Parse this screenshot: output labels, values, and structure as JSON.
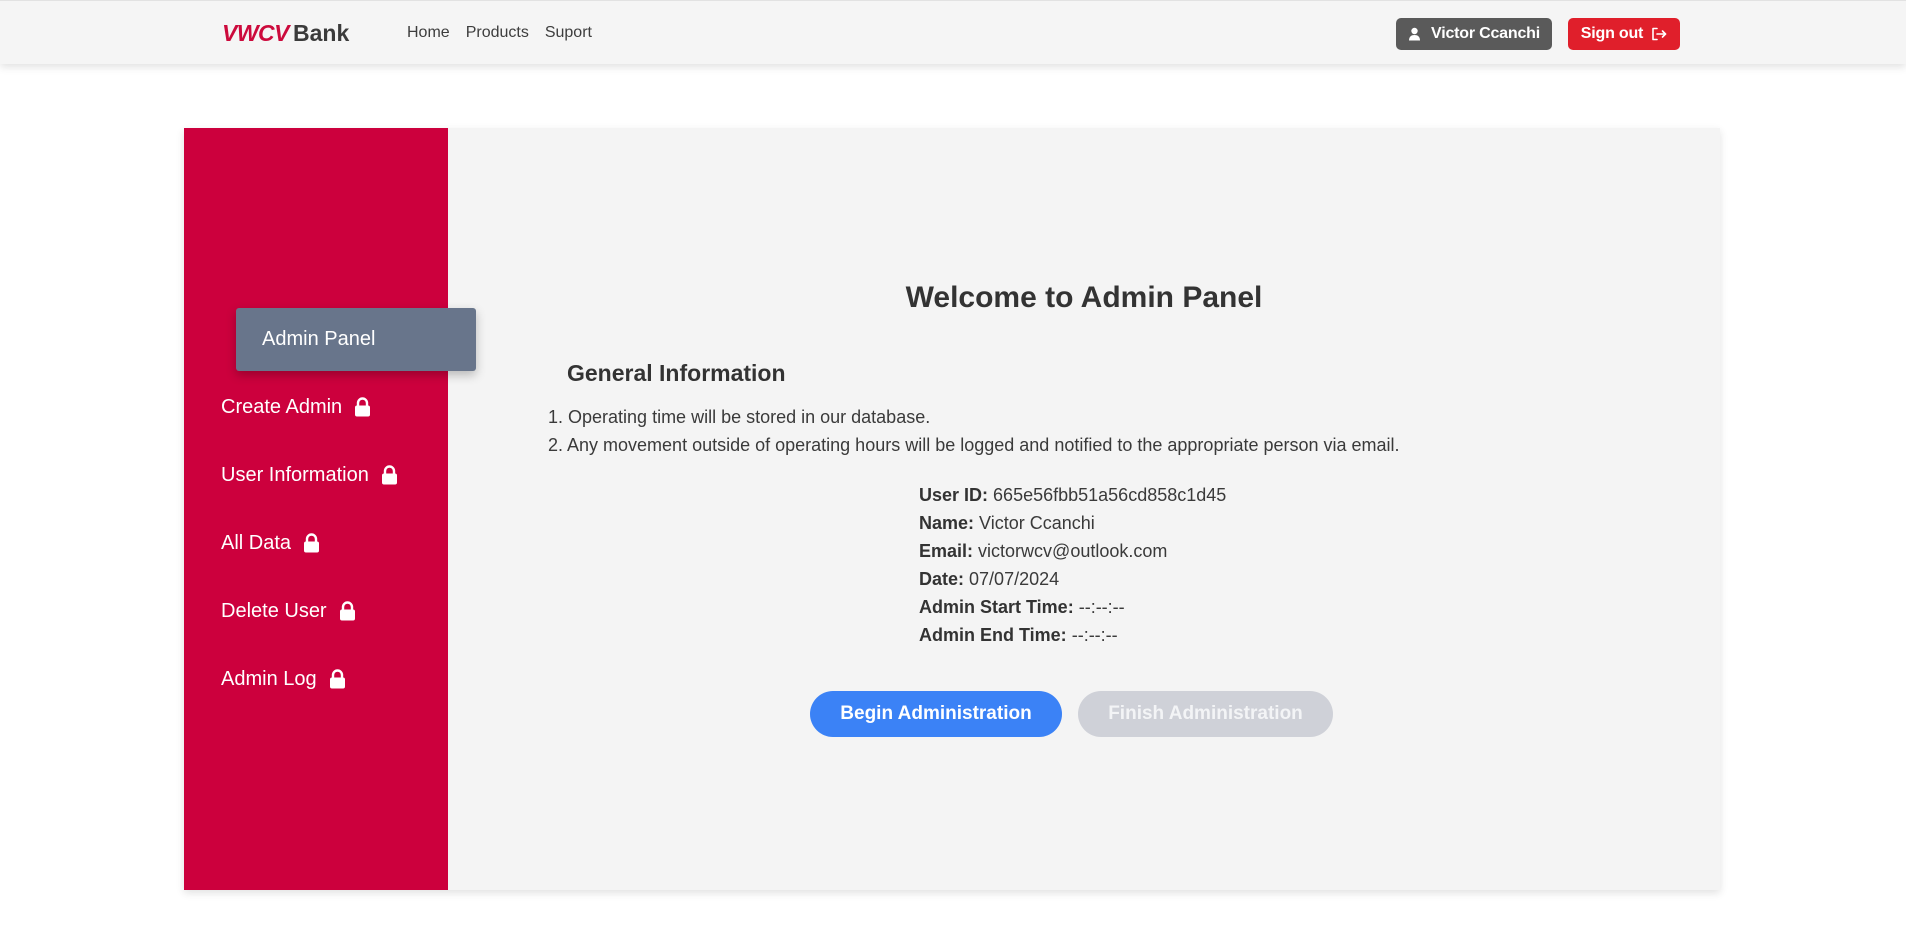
{
  "navbar": {
    "brand_mark": "VWCV",
    "brand_word": "Bank",
    "links": [
      "Home",
      "Products",
      "Suport"
    ],
    "user_name": "Victor Ccanchi",
    "signout_label": "Sign out"
  },
  "sidebar": {
    "active": "Admin Panel",
    "items": [
      {
        "label": "Create Admin",
        "icon": "lock-icon"
      },
      {
        "label": "User Information",
        "icon": "lock-icon"
      },
      {
        "label": "All Data",
        "icon": "lock-icon"
      },
      {
        "label": "Delete User",
        "icon": "lock-icon"
      },
      {
        "label": "Admin Log",
        "icon": "lock-icon"
      }
    ]
  },
  "main": {
    "title": "Welcome to Admin Panel",
    "section_title": "General Information",
    "notes": [
      "1. Operating time will be stored in our database.",
      "2. Any movement outside of operating hours will be logged and notified to the appropriate person via email."
    ],
    "details": [
      {
        "label": "User ID:",
        "value": "665e56fbb51a56cd858c1d45"
      },
      {
        "label": "Name:",
        "value": "Victor Ccanchi"
      },
      {
        "label": "Email:",
        "value": "victorwcv@outlook.com"
      },
      {
        "label": "Date:",
        "value": "07/07/2024"
      },
      {
        "label": "Admin Start Time:",
        "value": "--:--:--"
      },
      {
        "label": "Admin End Time:",
        "value": "--:--:--"
      }
    ],
    "begin_label": "Begin Administration",
    "finish_label": "Finish Administration"
  },
  "colors": {
    "brand": "#cc003d",
    "primary": "#3b82f6",
    "danger": "#e01f2b",
    "disabled": "#cfd1d8",
    "sidebar_active": "#68758b"
  }
}
